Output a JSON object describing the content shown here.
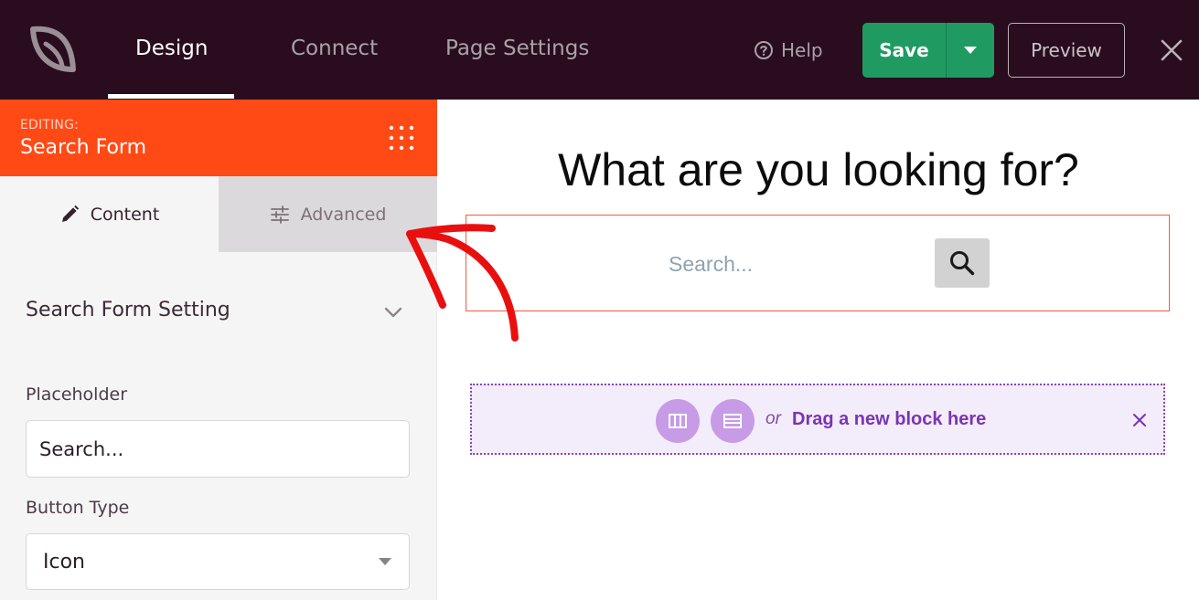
{
  "topbar": {
    "nav": [
      "Design",
      "Connect",
      "Page Settings"
    ],
    "help": "Help",
    "save": "Save",
    "preview": "Preview"
  },
  "sidebar": {
    "editing_label": "EDITING:",
    "editing_title": "Search Form",
    "tabs": {
      "content": "Content",
      "advanced": "Advanced"
    },
    "section_title": "Search Form Setting",
    "placeholder_label": "Placeholder",
    "placeholder_value": "Search...",
    "button_type_label": "Button Type",
    "button_type_value": "Icon"
  },
  "canvas": {
    "headline": "What are you looking for?",
    "search_placeholder": "Search...",
    "drop_or": "or",
    "drop_text": "Drag a new block here"
  },
  "colors": {
    "topbar_bg": "#2a0c1f",
    "accent_orange": "#ff4a16",
    "save_green": "#1f9b62",
    "drop_purple": "#7a34b3",
    "annotation_red": "#e8100f"
  },
  "icons": [
    "seedprod-logo-icon",
    "help-circle-icon",
    "caret-down-icon",
    "close-icon",
    "grip-dots-icon",
    "pencil-icon",
    "sliders-icon",
    "chevron-down-icon",
    "search-icon",
    "columns-icon",
    "rows-icon"
  ]
}
